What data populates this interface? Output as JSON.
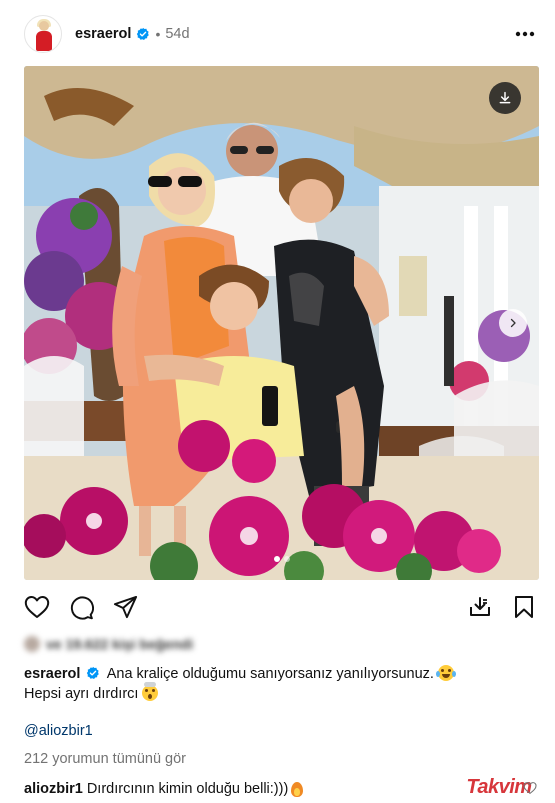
{
  "post": {
    "username": "esraerol",
    "age": "54d",
    "separator": "•"
  },
  "photo": {
    "description_icons": [
      "download-icon",
      "chevron-right-icon"
    ],
    "carousel_count": 2,
    "carousel_active": 0
  },
  "likes": {
    "text": "ve 19.622 kişi beğendi"
  },
  "caption": {
    "username": "esraerol",
    "line1": "Ana kraliçe olduğumu sanıyorsanız yanılıyorsunuz.",
    "line2": "Hepsi ayrı dırdırcı"
  },
  "mention": "@aliozbir1",
  "comments_link": "212 yorumun tümünü gör",
  "top_comment": {
    "username": "aliozbir1",
    "text": "Dırdırcının kimin olduğu belli:)))"
  },
  "watermark": "Takvim",
  "colors": {
    "link": "#00376b",
    "muted": "#737373",
    "verified": "#0095f6"
  }
}
